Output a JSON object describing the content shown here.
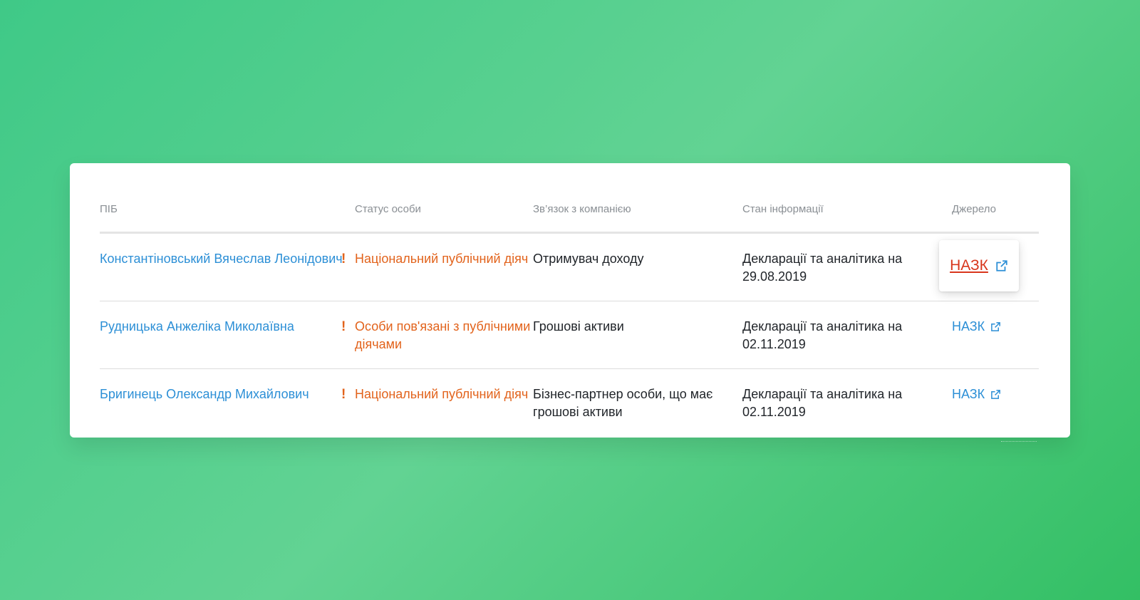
{
  "table": {
    "headers": {
      "name": "ПІБ",
      "status": "Статус особи",
      "relation": "Зв’язок з компанією",
      "state": "Стан інформації",
      "source": "Джерело"
    },
    "rows": [
      {
        "name": "Константіновський Вячеслав Леонідович",
        "status": "Національний публічний діяч",
        "relation": "Отримувач доходу",
        "state": "Декларації та аналітика на 29.08.2019",
        "source": "НАЗК"
      },
      {
        "name": "Рудницька Анжеліка Миколаївна",
        "status": "Особи пов'язані з публічними діячами",
        "relation": "Грошові активи",
        "state": "Декларації та аналітика на 02.11.2019",
        "source": "НАЗК"
      },
      {
        "name": "Бригинець Олександр Михайлович",
        "status": "Національний публічний діяч",
        "relation": "Бізнес-партнер особи, що має грошові активи",
        "state": "Декларації та аналітика на 02.11.2019",
        "source": "НАЗК"
      }
    ],
    "status_marker": "!"
  },
  "colors": {
    "link": "#2c8fd6",
    "status_warning": "#e2631c",
    "active_source_link": "#d8361c",
    "header_text": "#8a8f94"
  },
  "icons": {
    "status": "exclamation-icon",
    "source": "external-link-icon"
  }
}
